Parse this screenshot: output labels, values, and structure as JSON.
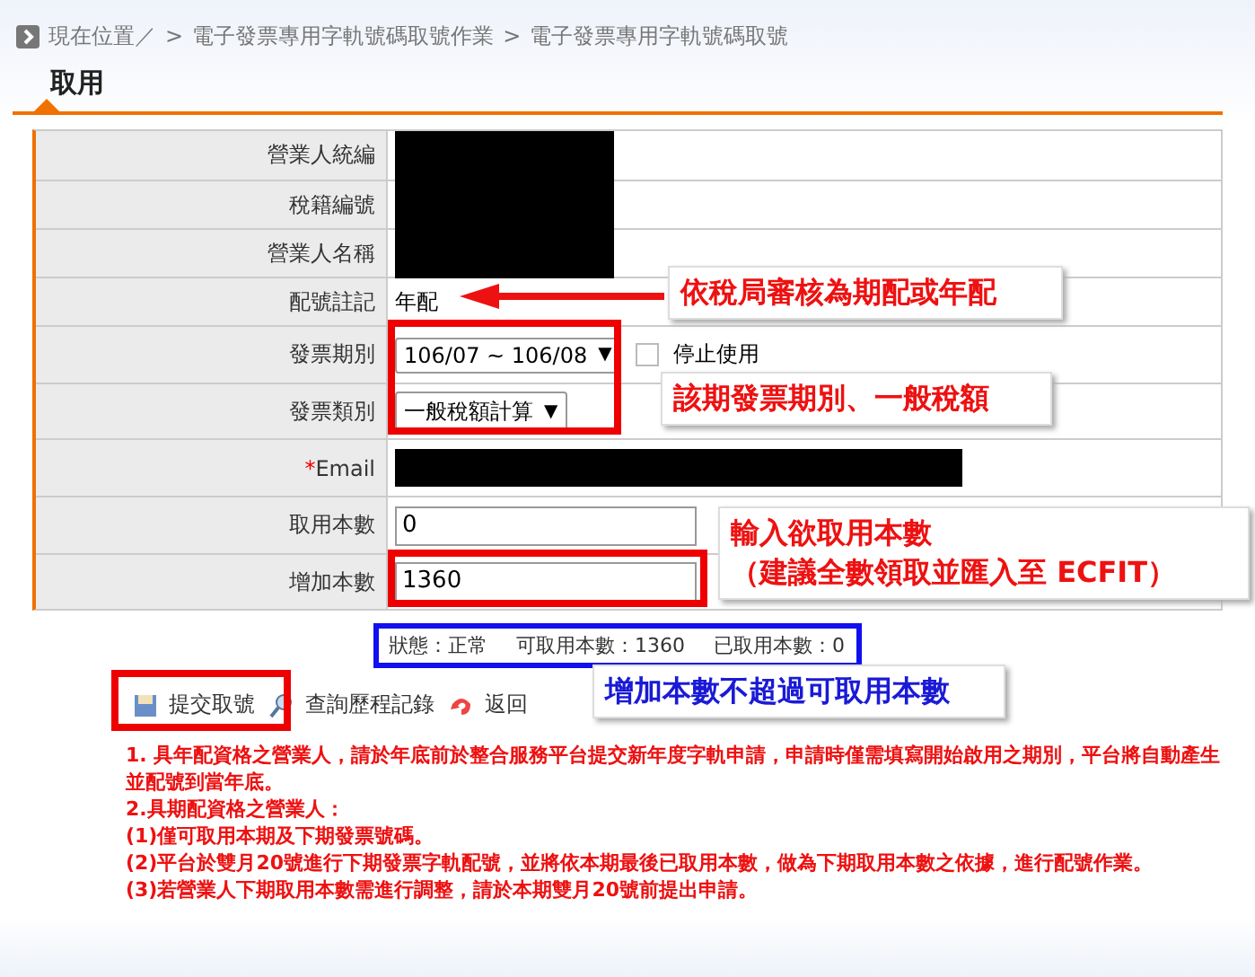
{
  "breadcrumb": {
    "label": "現在位置／",
    "separator": ">",
    "items": [
      "電子發票專用字軌號碼取號作業",
      "電子發票專用字軌號碼取號"
    ]
  },
  "title": "取用",
  "form": {
    "rows": [
      {
        "kind": "redacted",
        "label": "營業人統編"
      },
      {
        "kind": "redacted",
        "label": "稅籍編號"
      },
      {
        "kind": "redacted",
        "label": "營業人名稱"
      },
      {
        "kind": "text",
        "label": "配號註記",
        "value": "年配"
      },
      {
        "kind": "select",
        "label": "發票期別",
        "value": "106/07 ~ 106/08",
        "caret": "▼",
        "checkbox": {
          "label": "停止使用",
          "checked": false
        }
      },
      {
        "kind": "select",
        "label": "發票類別",
        "value": "一般稅額計算",
        "caret": "▼"
      },
      {
        "kind": "redacted_wide",
        "label": "Email",
        "required_mark": "*"
      },
      {
        "kind": "input",
        "label": "取用本數",
        "value": "0"
      },
      {
        "kind": "input",
        "label": "增加本數",
        "value": "1360"
      }
    ]
  },
  "status": [
    {
      "label": "狀態：",
      "value": "正常"
    },
    {
      "label": "可取用本數：",
      "value": "1360"
    },
    {
      "label": "已取用本數：",
      "value": "0"
    }
  ],
  "buttons": [
    {
      "kind": "save",
      "label": "提交取號"
    },
    {
      "kind": "search",
      "label": "查詢歷程記錄"
    },
    {
      "kind": "back",
      "label": "返回"
    }
  ],
  "notes": [
    "1. 具年配資格之營業人，請於年底前於整合服務平台提交新年度字軌申請，申請時僅需填寫開始啟用之期別，平台將自動產生並配號到當年底。",
    "2.具期配資格之營業人：",
    "(1)僅可取用本期及下期發票號碼。",
    "(2)平台於雙月20號進行下期發票字軌配號，並將依本期最後已取用本數，做為下期取用本數之依據，進行配號作業。",
    "(3)若營業人下期取用本數需進行調整，請於本期雙月20號前提出申請。"
  ],
  "annotations": [
    {
      "kind": "red",
      "text": "依稅局審核為期配或年配",
      "arrow": true
    },
    {
      "kind": "red",
      "text": "該期發票期別、一般稅額"
    },
    {
      "kind": "red",
      "text": "輸入欲取用本數",
      "text_2": "（建議全數領取並匯入至 ECFIT）"
    },
    {
      "kind": "blue",
      "text": "增加本數不超過可取用本數"
    }
  ]
}
